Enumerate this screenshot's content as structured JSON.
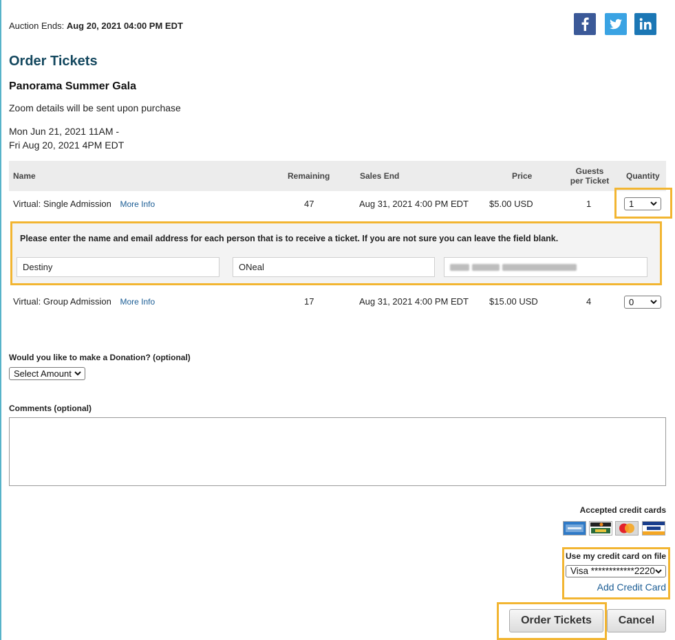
{
  "auction": {
    "label": "Auction Ends:",
    "value": "Aug 20, 2021 04:00 PM EDT"
  },
  "social": {
    "facebook_icon": "facebook-icon",
    "twitter_icon": "twitter-icon",
    "linkedin_icon": "linkedin-icon"
  },
  "page_title": "Order Tickets",
  "event": {
    "title": "Panorama Summer Gala",
    "description": "Zoom details will be sent upon purchase",
    "date_line1": "Mon Jun 21, 2021 11AM -",
    "date_line2": "Fri Aug 20, 2021 4PM EDT"
  },
  "table": {
    "headers": {
      "name": "Name",
      "remaining": "Remaining",
      "sales_end": "Sales End",
      "price": "Price",
      "guests_line1": "Guests",
      "guests_line2": "per Ticket",
      "quantity": "Quantity"
    },
    "rows": [
      {
        "name": "Virtual: Single Admission",
        "more": "More Info",
        "remaining": "47",
        "sales_end": "Aug 31, 2021 4:00 PM EDT",
        "price": "$5.00 USD",
        "guests": "1",
        "quantity": "1"
      },
      {
        "name": "Virtual: Group Admission",
        "more": "More Info",
        "remaining": "17",
        "sales_end": "Aug 31, 2021 4:00 PM EDT",
        "price": "$15.00 USD",
        "guests": "4",
        "quantity": "0"
      }
    ]
  },
  "attendee": {
    "note": "Please enter the name and email address for each person that is to receive a ticket. If you are not sure you can leave the field blank.",
    "first_name": "Destiny",
    "last_name": "ONeal"
  },
  "donation": {
    "label": "Would you like to make a Donation? (optional)",
    "selected": "Select Amount"
  },
  "comments": {
    "label": "Comments (optional)",
    "value": ""
  },
  "payment": {
    "accepted_label": "Accepted credit cards",
    "cards": [
      "amex-card-icon",
      "discover-card-icon",
      "mastercard-card-icon",
      "visa-card-icon"
    ],
    "use_card_label": "Use my credit card on file",
    "selected_card": "Visa ************2220",
    "add_card": "Add Credit Card"
  },
  "buttons": {
    "order": "Order Tickets",
    "cancel": "Cancel"
  },
  "colors": {
    "highlight": "#f2b531",
    "title": "#13475e",
    "link": "#1a5c94"
  }
}
